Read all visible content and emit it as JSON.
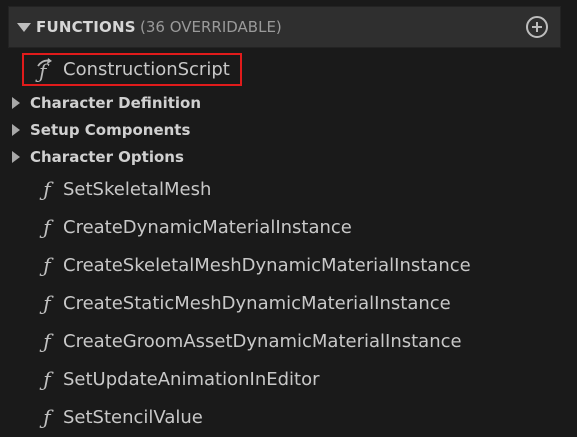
{
  "section": {
    "title": "FUNCTIONS",
    "count": "(36 OVERRIDABLE)"
  },
  "construction_script": {
    "label": "ConstructionScript"
  },
  "categories": [
    {
      "label": "Character Definition"
    },
    {
      "label": "Setup Components"
    },
    {
      "label": "Character Options"
    }
  ],
  "functions": [
    {
      "label": "SetSkeletalMesh"
    },
    {
      "label": "CreateDynamicMaterialInstance"
    },
    {
      "label": "CreateSkeletalMeshDynamicMaterialInstance"
    },
    {
      "label": "CreateStaticMeshDynamicMaterialInstance"
    },
    {
      "label": "CreateGroomAssetDynamicMaterialInstance"
    },
    {
      "label": "SetUpdateAnimationInEditor"
    },
    {
      "label": "SetStencilValue"
    }
  ],
  "icons": {
    "function": "function-icon",
    "construction": "construction-function-icon",
    "collapse": "collapse-arrow-icon",
    "expand": "expand-arrow-icon",
    "add": "add-circle-icon"
  },
  "colors": {
    "background": "#1a1a1a",
    "header_background": "#2f2f2f",
    "highlight_border": "#e01b1b",
    "text": "#c8c8c8"
  },
  "glyphs": {
    "function": "ƒ"
  }
}
